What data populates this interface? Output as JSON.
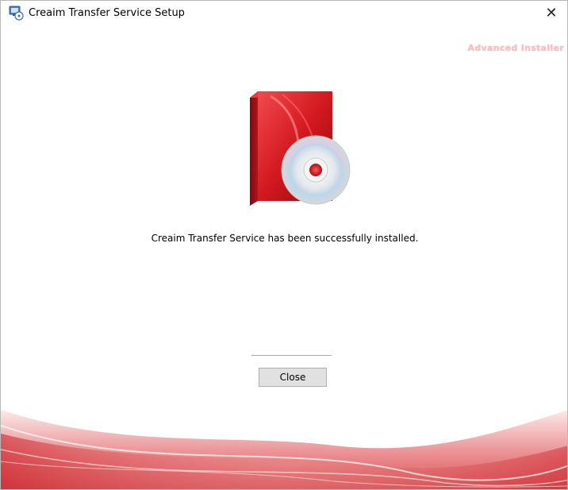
{
  "window": {
    "title": "Creaim Transfer Service Setup",
    "close_glyph": "✕",
    "brand_label": "Advanced Installer"
  },
  "icons": {
    "app": "installer-app-icon",
    "product": "software-box-cd-icon",
    "close": "close-icon"
  },
  "main": {
    "message": "Creaim Transfer Service has been successfully installed.",
    "close_button_label": "Close"
  },
  "colors": {
    "accent_red": "#c8161d",
    "button_face": "#e1e1e1",
    "button_border": "#adadad"
  }
}
